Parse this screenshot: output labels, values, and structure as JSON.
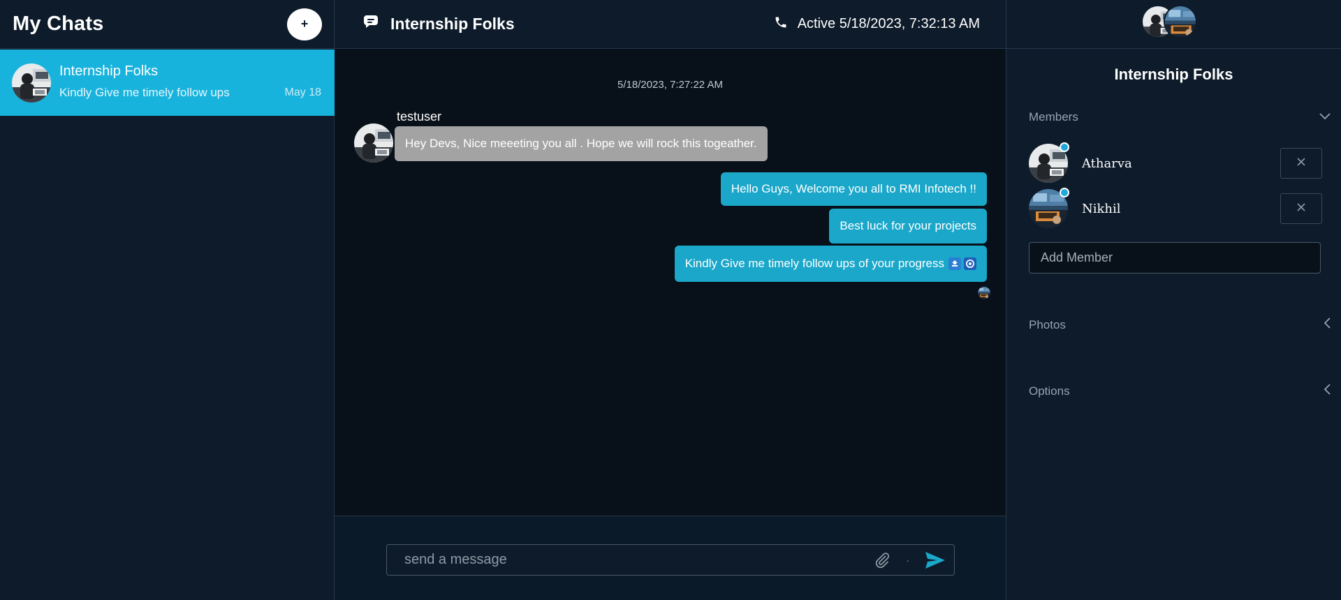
{
  "sidebar": {
    "title": "My Chats",
    "new_chat_label": "+",
    "chats": [
      {
        "name": "Internship Folks",
        "preview": "Kindly Give me timely follow ups",
        "date": "May 18"
      }
    ]
  },
  "header": {
    "group_name": "Internship Folks",
    "status": "Active 5/18/2023, 7:32:13 AM"
  },
  "messages": {
    "timestamp": "5/18/2023, 7:27:22 AM",
    "incoming": {
      "sender": "testuser",
      "text": "Hey Devs, Nice meeeting you all . Hope we will rock this togeather."
    },
    "outgoing": [
      {
        "text": "Hello Guys, Welcome you all to RMI Infotech !!"
      },
      {
        "text": "Best luck for your projects"
      },
      {
        "text": "Kindly Give me timely follow ups of your progress"
      }
    ]
  },
  "composer": {
    "placeholder": "send a message",
    "separator": "·"
  },
  "right_panel": {
    "title": "Internship Folks",
    "members_label": "Members",
    "members": [
      {
        "name": "Atharva"
      },
      {
        "name": "Nikhil"
      }
    ],
    "add_member_placeholder": "Add Member",
    "photos_label": "Photos",
    "options_label": "Options"
  },
  "colors": {
    "sidebar_bg": "#0d1b2a",
    "chat_bg": "#081019",
    "accent": "#18b3dd",
    "outgoing_bubble": "#1ba7ca",
    "incoming_bubble": "#a3a3a3",
    "online_dot": "#1fa8d8"
  },
  "icons": {
    "new_chat": "plus-icon",
    "group": "chat-bubbles-icon",
    "call": "phone-icon",
    "attach": "paperclip-icon",
    "send": "send-icon",
    "members_toggle": "chevron-down-icon",
    "photos_toggle": "chevron-left-icon",
    "options_toggle": "chevron-left-icon",
    "remove_member": "close-icon",
    "emoji_1": "up-arrow-emoji",
    "emoji_2": "nazar-amulet-emoji"
  }
}
